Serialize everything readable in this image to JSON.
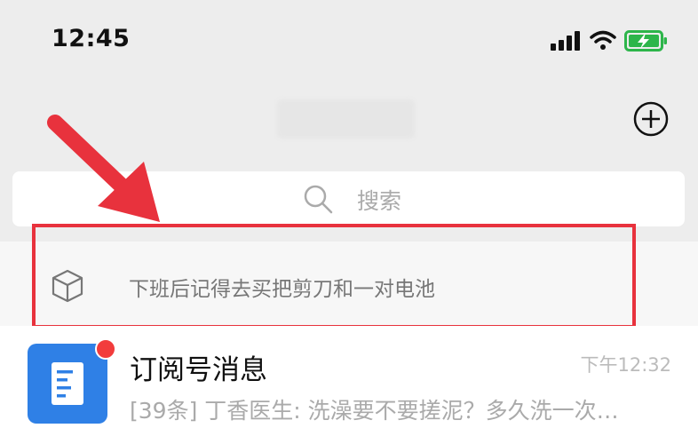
{
  "status_bar": {
    "time": "12:45",
    "icons": [
      "signal-icon",
      "wifi-icon",
      "battery-charging-icon"
    ],
    "battery_color": "#2db54a"
  },
  "header": {
    "add_icon": "plus-circle-icon"
  },
  "search": {
    "label": "搜索",
    "icon": "search-icon"
  },
  "reminder": {
    "icon": "box-icon",
    "text": "下班后记得去买把剪刀和一对电池"
  },
  "annotation": {
    "color": "#e8323d"
  },
  "chats": [
    {
      "name": "订阅号消息",
      "time": "下午12:32",
      "preview": "[39条] 丁香医生: 洗澡要不要搓泥？多久洗一次…",
      "avatar_icon": "document-icon",
      "avatar_color": "#2f80e6",
      "unread": true
    }
  ]
}
